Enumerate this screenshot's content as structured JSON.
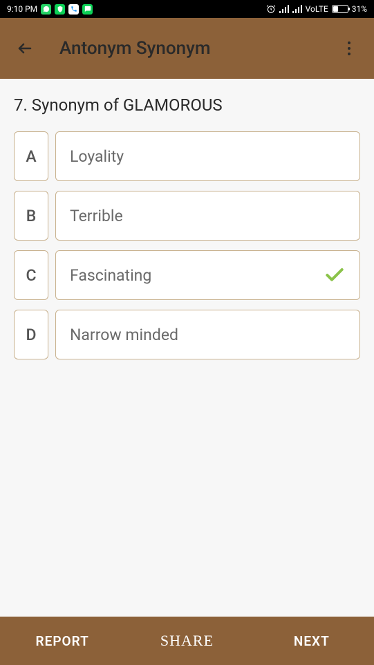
{
  "status_bar": {
    "time": "9:10 PM",
    "volte": "VoLTE",
    "battery": "31%"
  },
  "app_bar": {
    "title": "Antonym Synonym"
  },
  "question": {
    "text": "7. Synonym of GLAMOROUS"
  },
  "options": [
    {
      "letter": "A",
      "text": "Loyality",
      "correct": false
    },
    {
      "letter": "B",
      "text": "Terrible",
      "correct": false
    },
    {
      "letter": "C",
      "text": "Fascinating",
      "correct": true
    },
    {
      "letter": "D",
      "text": "Narrow minded",
      "correct": false
    }
  ],
  "bottom_bar": {
    "report": "REPORT",
    "share": "SHARE",
    "next": "NEXT"
  }
}
